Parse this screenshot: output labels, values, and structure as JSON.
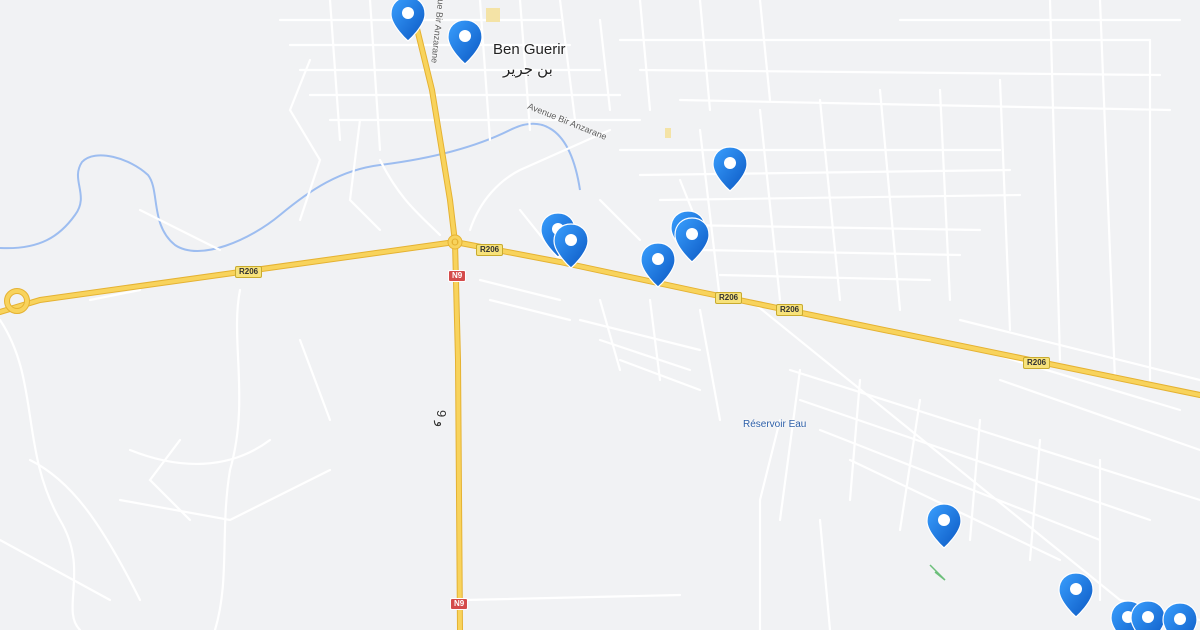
{
  "map": {
    "city": {
      "name": "Ben Guerir",
      "name_ar": "بن جرير"
    },
    "poi": {
      "reservoir": "Réservoir Eau"
    },
    "streets": {
      "avenue_bir_anzarane": "Avenue Bir Anzarane",
      "bir_anzarane_vertical": "ue Bir Anzarane"
    },
    "roads": {
      "r206": "R206",
      "n9": "N9",
      "n9_ar": "و 9"
    },
    "colors": {
      "background": "#f1f2f4",
      "minor_road": "#ffffff",
      "major_road": "#f5c542",
      "major_road_casing": "#e0a92a",
      "water": "#8ab4f8",
      "marker": "#1a73e8",
      "marker_dark": "#0b57c2"
    },
    "markers": {
      "count": 15,
      "icon": "map-pin-icon"
    }
  }
}
